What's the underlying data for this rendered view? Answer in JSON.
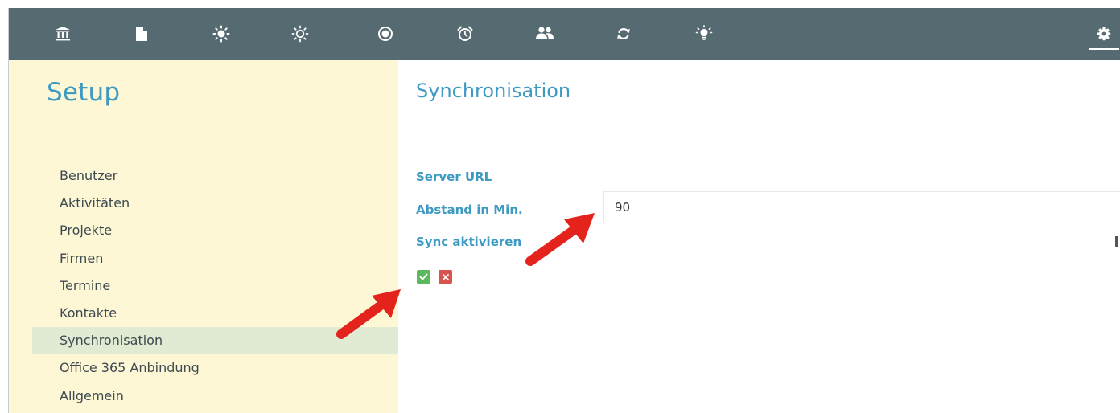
{
  "nav": {
    "icons": [
      "bank-icon",
      "document-icon",
      "sun-icon",
      "sun-outline-icon",
      "record-icon",
      "alarm-clock-icon",
      "users-icon",
      "refresh-icon",
      "lightbulb-icon",
      "gear-icon"
    ],
    "active": "gear-icon"
  },
  "sidebar": {
    "title": "Setup",
    "items": [
      {
        "label": "Benutzer"
      },
      {
        "label": "Aktivitäten"
      },
      {
        "label": "Projekte"
      },
      {
        "label": "Firmen"
      },
      {
        "label": "Termine"
      },
      {
        "label": "Kontakte"
      },
      {
        "label": "Synchronisation",
        "active": true
      },
      {
        "label": "Office 365 Anbindung"
      },
      {
        "label": "Allgemein"
      }
    ]
  },
  "main": {
    "title": "Synchronisation",
    "fields": {
      "server_url_label": "Server URL",
      "interval_label": "Abstand in Min.",
      "interval_value": "90",
      "sync_label": "Sync aktivieren"
    }
  },
  "colors": {
    "topbar": "#566a72",
    "sidebar_bg": "#fdf7d6",
    "sidebar_active": "#e1ebd3",
    "accent": "#3f9ac2",
    "ok": "#5cb85c",
    "cancel": "#d9534f",
    "arrow": "#e3231c"
  }
}
